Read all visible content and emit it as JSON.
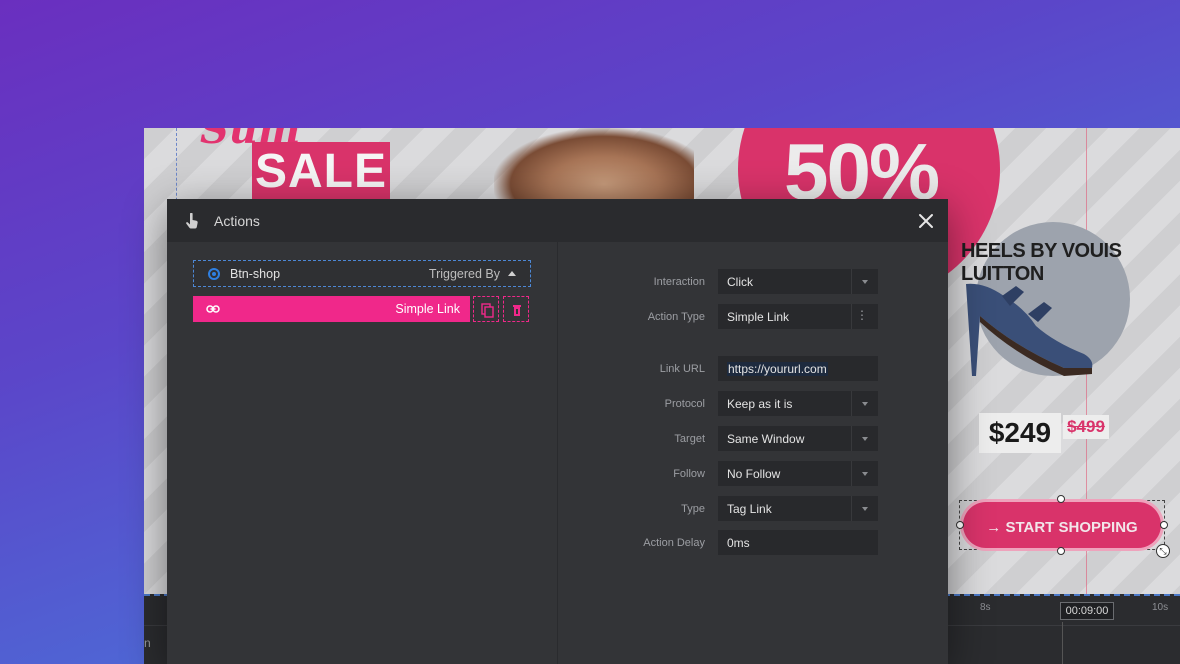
{
  "banner": {
    "sale_text": "SALE",
    "discount_text": "50%",
    "product_title": "HEELS BY VOUIS LUITTON",
    "price": "$249",
    "old_price": "$499",
    "cta_label": "→ START SHOPPING"
  },
  "timeline": {
    "marker_8s": "8s",
    "marker_10s": "10s",
    "current_time": "00:09:00",
    "left_label": "n"
  },
  "modal": {
    "title": "Actions",
    "trigger": {
      "layer_name": "Btn-shop",
      "label": "Triggered By"
    },
    "action": {
      "label": "Simple Link"
    },
    "form": {
      "interaction": {
        "label": "Interaction",
        "value": "Click"
      },
      "action_type": {
        "label": "Action Type",
        "value": "Simple Link"
      },
      "link_url": {
        "label": "Link URL",
        "value": "https://yoururl.com"
      },
      "protocol": {
        "label": "Protocol",
        "value": "Keep as it is"
      },
      "target": {
        "label": "Target",
        "value": "Same Window"
      },
      "follow": {
        "label": "Follow",
        "value": "No Follow"
      },
      "type": {
        "label": "Type",
        "value": "Tag Link"
      },
      "action_delay": {
        "label": "Action Delay",
        "value": "0ms"
      }
    }
  },
  "colors": {
    "accent_pink": "#f0288a",
    "banner_pink": "#d9336a",
    "selection_blue": "#2f7fe0"
  },
  "icons": [
    "touch-hand-icon",
    "close-icon",
    "radio-selected-icon",
    "caret-up-icon",
    "link-icon",
    "copy-icon",
    "trash-icon",
    "chevron-down-icon",
    "more-vertical-icon",
    "resize-icon"
  ]
}
